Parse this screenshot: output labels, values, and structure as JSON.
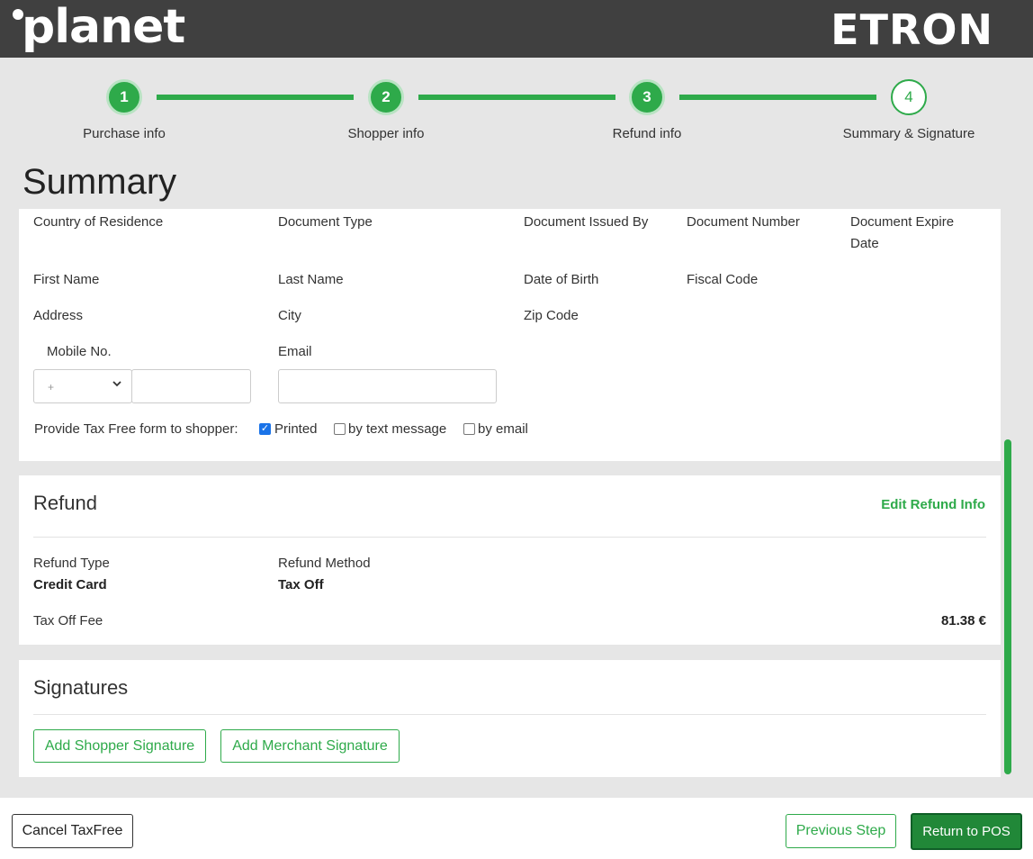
{
  "header": {
    "brand_left": "planet",
    "brand_right": "ETRON"
  },
  "stepper": {
    "steps": [
      {
        "number": "1",
        "label": "Purchase info"
      },
      {
        "number": "2",
        "label": "Shopper info"
      },
      {
        "number": "3",
        "label": "Refund info"
      },
      {
        "number": "4",
        "label": "Summary & Signature"
      }
    ]
  },
  "page_title": "Summary",
  "shopper": {
    "country_label": "Country of Residence",
    "doc_type_label": "Document Type",
    "doc_issued_label": "Document Issued By",
    "doc_number_label": "Document Number",
    "doc_expire_label_1": "Document Expire",
    "doc_expire_label_2": "Date",
    "first_name_label": "First Name",
    "last_name_label": "Last Name",
    "dob_label": "Date of Birth",
    "fiscal_label": "Fiscal Code",
    "address_label": "Address",
    "city_label": "City",
    "zip_label": "Zip Code",
    "mobile_label": "Mobile No.",
    "mobile_prefix": "+",
    "email_label": "Email",
    "provide_label": "Provide Tax Free form to shopper:",
    "options": {
      "printed": "Printed",
      "text": "by text message",
      "email": "by email"
    }
  },
  "refund": {
    "title": "Refund",
    "edit_link": "Edit Refund Info",
    "type_label": "Refund Type",
    "type_value": "Credit Card",
    "method_label": "Refund Method",
    "method_value": "Tax Off",
    "fee_label": "Tax Off Fee",
    "fee_value": "81.38 €"
  },
  "signatures": {
    "title": "Signatures",
    "shopper_btn": "Add Shopper Signature",
    "merchant_btn": "Add Merchant Signature"
  },
  "footer": {
    "cancel": "Cancel TaxFree",
    "previous": "Previous Step",
    "return": "Return to POS"
  },
  "colors": {
    "accent": "#2eaa4a",
    "header_bg": "#404040",
    "page_bg": "#e6e6e6"
  }
}
